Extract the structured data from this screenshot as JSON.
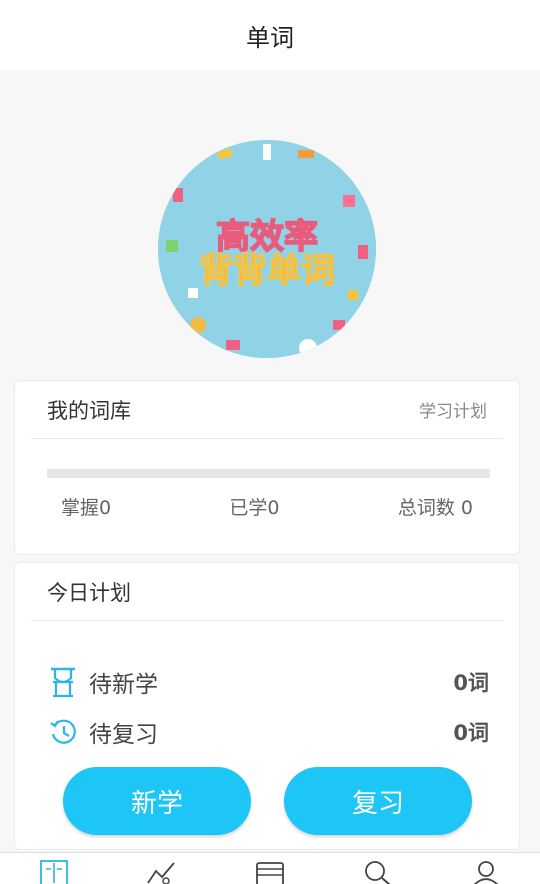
{
  "header": {
    "title": "单词"
  },
  "banner": {
    "text_line1": "高效率",
    "text_line2": "背背单词"
  },
  "library": {
    "title": "我的词库",
    "plan_link": "学习计划",
    "progress": 0,
    "mastered": "掌握0",
    "learned": "已学0",
    "total": "总词数 0"
  },
  "today": {
    "title": "今日计划",
    "new_label": "待新学",
    "new_count": "0词",
    "review_label": "待复习",
    "review_count": "0词",
    "new_button": "新学",
    "review_button": "复习"
  },
  "tabbar": {
    "tabs": [
      {
        "icon": "book-icon",
        "active": true
      },
      {
        "icon": "chart-icon",
        "active": false
      },
      {
        "icon": "cards-icon",
        "active": false
      },
      {
        "icon": "search-icon",
        "active": false
      },
      {
        "icon": "user-icon",
        "active": false
      }
    ]
  },
  "colors": {
    "accent": "#1dc6f6",
    "icon": "#2ab6e6"
  }
}
